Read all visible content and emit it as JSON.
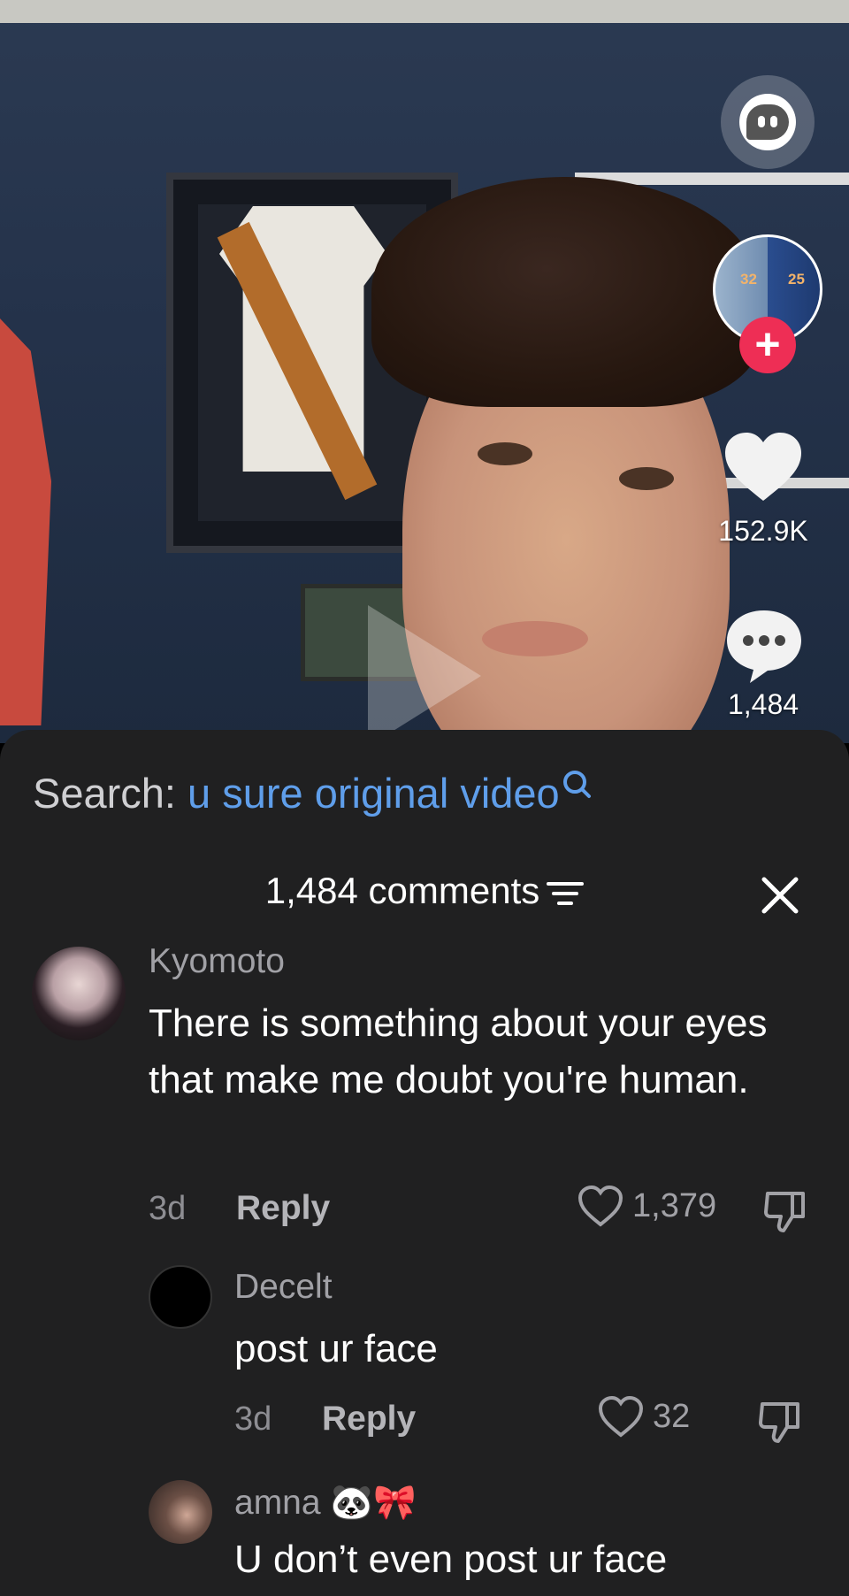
{
  "video": {
    "like_count": "152.9K",
    "comment_count": "1,484",
    "author_jersey_numbers": [
      "32",
      "25"
    ]
  },
  "search": {
    "label": "Search:",
    "query": "u sure original video"
  },
  "comments_header": {
    "title": "1,484 comments"
  },
  "comments": [
    {
      "username": "Kyomoto",
      "text": "There is something about your eyes that make me doubt you're human.",
      "age": "3d",
      "reply_label": "Reply",
      "likes": "1,379"
    }
  ],
  "replies": [
    {
      "username": "Decelt",
      "text": "post ur face",
      "age": "3d",
      "reply_label": "Reply",
      "likes": "32"
    },
    {
      "username": "amna 🐼🎀",
      "text": "U don’t even post ur face"
    }
  ],
  "colors": {
    "sheet_bg": "#202021",
    "search_query": "#5f9eea",
    "follow_red": "#ee2e55"
  }
}
